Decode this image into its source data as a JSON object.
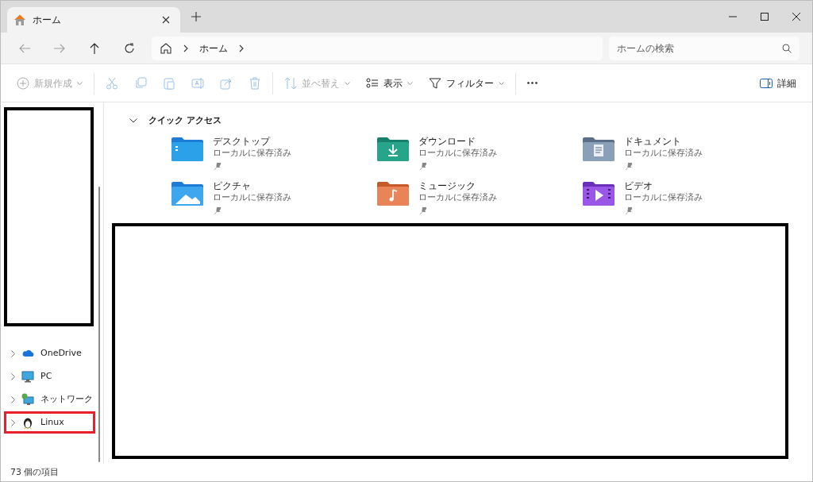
{
  "window": {
    "tabs": [
      {
        "label": "ホーム",
        "selected": true
      }
    ]
  },
  "nav": [
    {
      "kind": "back",
      "disabled": true
    },
    {
      "kind": "forward",
      "disabled": true
    },
    {
      "kind": "up",
      "disabled": false
    },
    {
      "kind": "refresh",
      "disabled": false
    }
  ],
  "address": {
    "crumbs": [
      "ホーム"
    ]
  },
  "search": {
    "placeholder": "ホームの検索"
  },
  "toolbar": [
    {
      "kind": "new",
      "label": "新規作成",
      "dropdown": true,
      "disabled": true
    },
    {
      "kind": "separator"
    },
    {
      "kind": "cut",
      "disabled": true
    },
    {
      "kind": "copy",
      "disabled": true
    },
    {
      "kind": "paste",
      "disabled": true
    },
    {
      "kind": "rename",
      "disabled": true
    },
    {
      "kind": "share",
      "disabled": true
    },
    {
      "kind": "delete",
      "disabled": true
    },
    {
      "kind": "separator"
    },
    {
      "kind": "sort",
      "label": "並べ替え",
      "dropdown": true,
      "disabled": true
    },
    {
      "kind": "view",
      "label": "表示",
      "dropdown": true,
      "disabled": false
    },
    {
      "kind": "filter",
      "label": "フィルター",
      "dropdown": true,
      "disabled": false
    },
    {
      "kind": "separator"
    },
    {
      "kind": "more",
      "disabled": false
    }
  ],
  "details": {
    "label": "詳細"
  },
  "sidebar": {
    "redacted_block": true,
    "items": [
      {
        "kind": "cloud",
        "label": "OneDrive",
        "expanded": false,
        "highlighted": false
      },
      {
        "kind": "pc",
        "label": "PC",
        "expanded": false,
        "highlighted": false
      },
      {
        "kind": "network",
        "label": "ネットワーク",
        "expanded": false,
        "highlighted": false
      },
      {
        "kind": "penguin",
        "label": "Linux",
        "expanded": false,
        "highlighted": true
      }
    ]
  },
  "quick_access": {
    "title": "クイック アクセス",
    "expanded": true,
    "items": [
      {
        "kind": "desktop",
        "name": "デスクトップ",
        "subtitle": "ローカルに保存済み",
        "pinned": true
      },
      {
        "kind": "download",
        "name": "ダウンロード",
        "subtitle": "ローカルに保存済み",
        "pinned": true
      },
      {
        "kind": "documents",
        "name": "ドキュメント",
        "subtitle": "ローカルに保存済み",
        "pinned": true
      },
      {
        "kind": "pictures",
        "name": "ピクチャ",
        "subtitle": "ローカルに保存済み",
        "pinned": true
      },
      {
        "kind": "music",
        "name": "ミュージック",
        "subtitle": "ローカルに保存済み",
        "pinned": true
      },
      {
        "kind": "video",
        "name": "ビデオ",
        "subtitle": "ローカルに保存済み",
        "pinned": true
      }
    ]
  },
  "content": {
    "redacted_block": true
  },
  "status_bar": {
    "text": "73 個の項目"
  }
}
